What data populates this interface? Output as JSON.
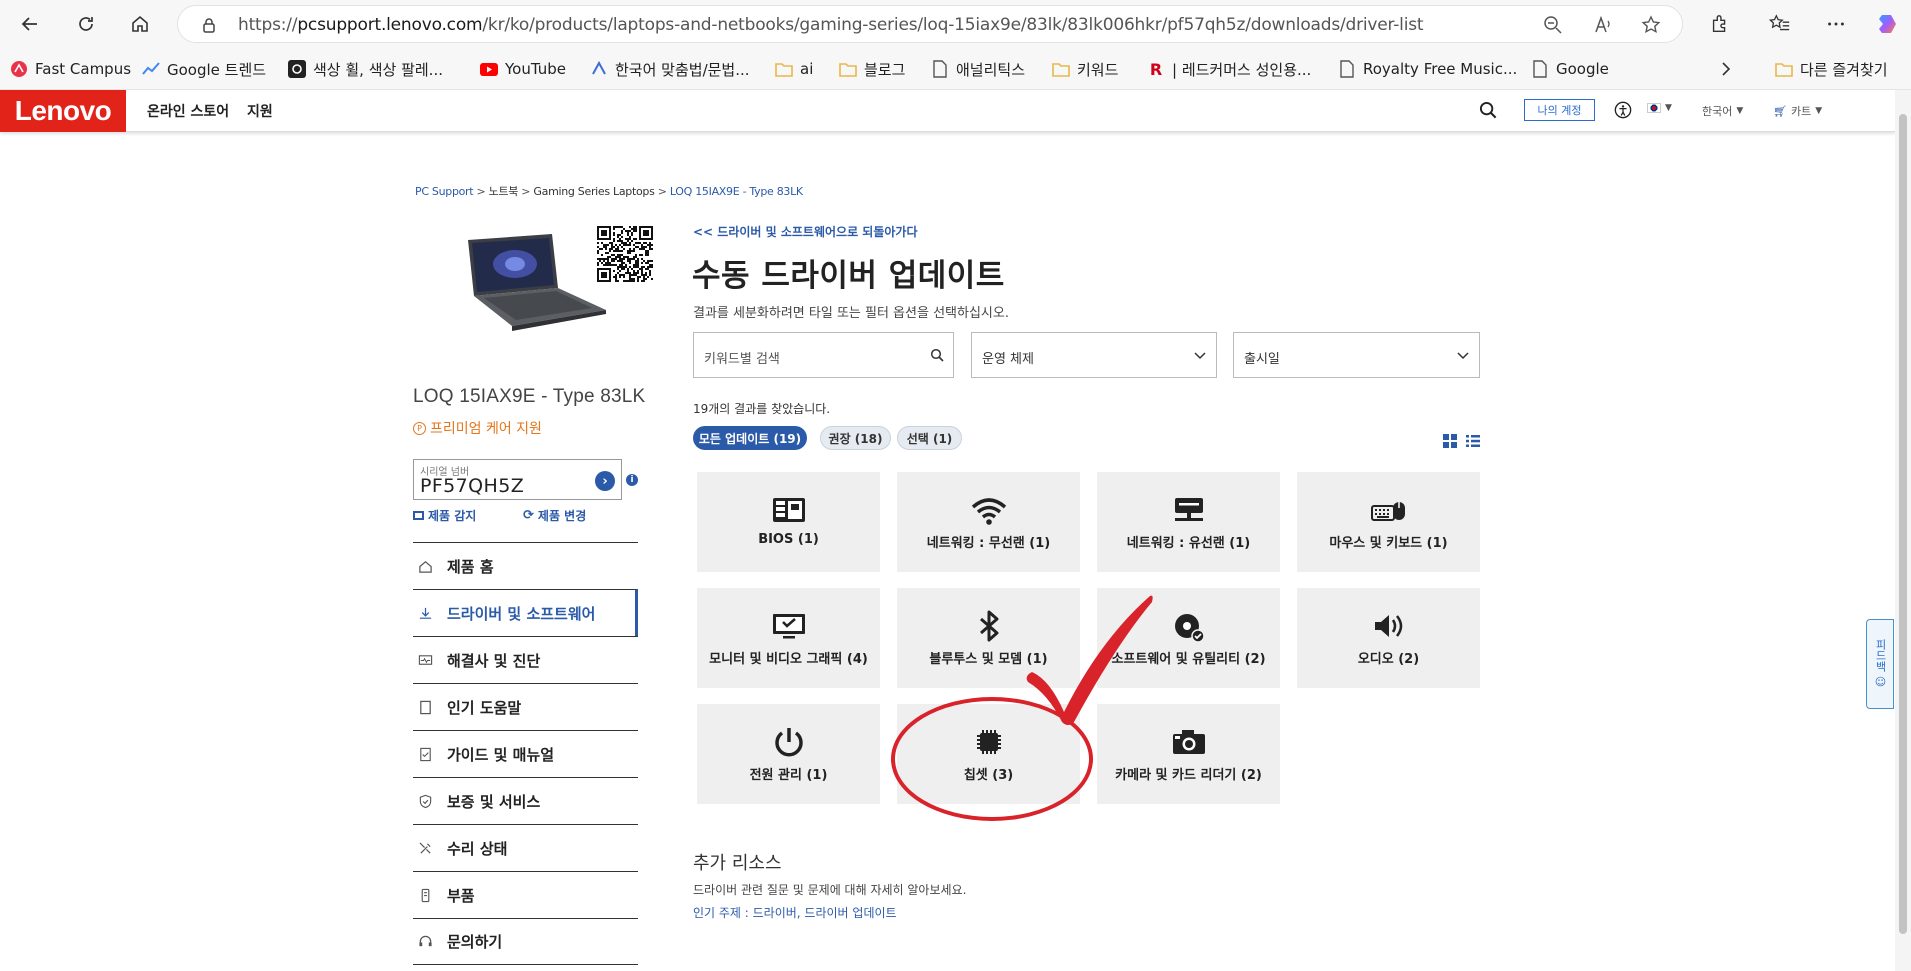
{
  "browser": {
    "url_prefix": "https://",
    "url_host": "pcsupport.lenovo.com",
    "url_path": "/kr/ko/products/laptops-and-netbooks/gaming-series/loq-15iax9e/83lk/83lk006hkr/pf57qh5z/downloads/driver-list",
    "bookmarks": [
      {
        "label": "Fast Campus",
        "icon": "fastcampus-icon",
        "color": "#e8334a"
      },
      {
        "label": "Google 트렌드",
        "icon": "trends-icon",
        "color": "#4285f4"
      },
      {
        "label": "색상 휠, 색상 팔레...",
        "icon": "adobe-color-icon",
        "color": "#222"
      },
      {
        "label": "YouTube",
        "icon": "youtube-icon",
        "color": "#ff0000"
      },
      {
        "label": "한국어 맞춤법/문법...",
        "icon": "spell-icon",
        "color": "#3a6fd8"
      },
      {
        "label": "ai",
        "icon": "folder-icon",
        "color": "#e8b74a"
      },
      {
        "label": "블로그",
        "icon": "folder-icon",
        "color": "#e8b74a"
      },
      {
        "label": "애널리틱스",
        "icon": "page-icon",
        "color": "#555"
      },
      {
        "label": "키워드",
        "icon": "folder-icon",
        "color": "#e8b74a"
      },
      {
        "label": "| 레드커머스 성인용...",
        "icon": "r-icon",
        "color": "#d0021b"
      },
      {
        "label": "Royalty Free Music...",
        "icon": "page-icon",
        "color": "#555"
      },
      {
        "label": "Google",
        "icon": "page-icon",
        "color": "#555"
      }
    ],
    "other_favorites": "다른 즐겨찾기"
  },
  "site": {
    "logo": "Lenovo",
    "nav": [
      "온라인 스토어",
      "지원"
    ],
    "account": "나의 계정",
    "language": "한국어",
    "cart": "카트",
    "feedback": "피드백 ☺"
  },
  "breadcrumb": {
    "items": [
      "PC Support",
      "노트북",
      "Gaming Series Laptops"
    ],
    "current": "LOQ 15IAX9E - Type 83LK",
    "separator": ">"
  },
  "product": {
    "name": "LOQ 15IAX9E - Type 83LK",
    "premium": "프리미엄 케어 지원",
    "serial_label": "시리얼 넘버",
    "serial": "PF57QH5Z",
    "detect": "제품 감지",
    "change": "제품 변경"
  },
  "side_nav": [
    {
      "label": "제품 홈",
      "icon": "home-icon",
      "active": false
    },
    {
      "label": "드라이버 및 소프트웨어",
      "icon": "download-icon",
      "active": true
    },
    {
      "label": "해결사 및 진단",
      "icon": "diagnostic-icon",
      "active": false
    },
    {
      "label": "인기 도움말",
      "icon": "doc-icon",
      "active": false
    },
    {
      "label": "가이드 및 매뉴얼",
      "icon": "manual-icon",
      "active": false
    },
    {
      "label": "보증 및 서비스",
      "icon": "shield-icon",
      "active": false
    },
    {
      "label": "수리 상태",
      "icon": "tools-icon",
      "active": false
    },
    {
      "label": "부품",
      "icon": "parts-icon",
      "active": false
    },
    {
      "label": "문의하기",
      "icon": "headset-icon",
      "active": false
    }
  ],
  "main": {
    "back": "<< 드라이버 및 소프트웨어으로 되돌아가다",
    "title": "수동 드라이버 업데이트",
    "subtitle": "결과를 세분화하려면 타일 또는 필터 옵션을 선택하십시오.",
    "search_placeholder": "키워드별 검색",
    "os_filter": "운영 체제",
    "date_filter": "출시일",
    "result_count": "19개의 결과를 찾았습니다.",
    "chips": [
      "모든 업데이트 (19)",
      "권장 (18)",
      "선택 (1)"
    ]
  },
  "tiles": [
    {
      "label": "BIOS (1)",
      "icon": "bios-icon"
    },
    {
      "label": "네트워킹 : 무선랜 (1)",
      "icon": "wifi-icon"
    },
    {
      "label": "네트워킹 : 유선랜 (1)",
      "icon": "ethernet-icon"
    },
    {
      "label": "마우스 및 키보드 (1)",
      "icon": "keyboard-mouse-icon"
    },
    {
      "label": "모니터 및 비디오 그래픽 (4)",
      "icon": "monitor-icon"
    },
    {
      "label": "블루투스 및 모뎀 (1)",
      "icon": "bluetooth-icon"
    },
    {
      "label": "소프트웨어 및 유틸리티 (2)",
      "icon": "software-icon"
    },
    {
      "label": "오디오 (2)",
      "icon": "audio-icon"
    },
    {
      "label": "전원 관리 (1)",
      "icon": "power-icon"
    },
    {
      "label": "칩셋 (3)",
      "icon": "chipset-icon"
    },
    {
      "label": "카메라 및 카드 리더기 (2)",
      "icon": "camera-icon"
    }
  ],
  "resources": {
    "title": "추가 리소스",
    "text": "드라이버 관련 질문 및 문제에 대해 자세히 알아보세요.",
    "topics": "인기 주제 : 드라이버, 드라이버 업데이트"
  },
  "colors": {
    "brand": "#e2231a",
    "accent": "#2b5aa8",
    "annotation": "#d8232a"
  }
}
